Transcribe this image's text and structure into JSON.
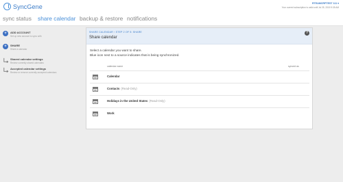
{
  "app": {
    "logo_text": "SyncGene",
    "account_email": "RTEAMCRPTEST 111 ▾",
    "subscription_text": "Your current subscription is valid until Jul 25, 2015 9:35 AM"
  },
  "nav": {
    "tabs": [
      {
        "label": "sync status"
      },
      {
        "label": "share calendar"
      },
      {
        "label": "backup & restore"
      },
      {
        "label": "notifications"
      }
    ],
    "active": "share calendar"
  },
  "sidebar": {
    "items": [
      {
        "title": "ADD ACCOUNT",
        "desc": "Set up new account to sync with",
        "icon": "plus-icon"
      },
      {
        "title": "SHARE",
        "desc": "Share a calendar",
        "icon": "plus-icon"
      },
      {
        "title": "Shared calendar settings",
        "desc": "Review currently shared calendars",
        "icon": "arrow-icon"
      },
      {
        "title": "Accepted calendar settings",
        "desc": "Review or remove currently accepted calendars",
        "icon": "arrow-icon"
      }
    ]
  },
  "card": {
    "step": "SHARE CALENDAR  ›  STEP 2 OF 5: SHARE",
    "title": "Share calendar",
    "intro_line1": "Select a calendar you want to share.",
    "intro_line2": "Blue icon next to a source indicates that is being synchronized.",
    "col_name": "calendar name",
    "col_synced": "synced as",
    "calendars": [
      {
        "name": "Calendar",
        "readonly": ""
      },
      {
        "name": "Contacts",
        "readonly": "(Read-Only)"
      },
      {
        "name": "Holidays in the United States",
        "readonly": "(Read-Only)"
      },
      {
        "name": "Work",
        "readonly": ""
      }
    ]
  },
  "colors": {
    "accent": "#4a90d9",
    "sidebar_icon": "#3b6fc2",
    "card_head": "#e6eef8",
    "background": "#ededed"
  }
}
